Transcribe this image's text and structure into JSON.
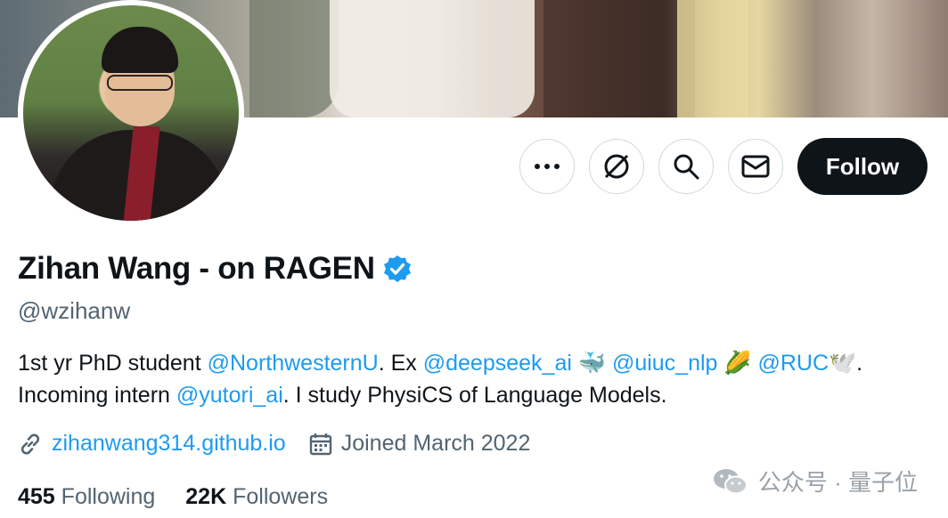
{
  "profile": {
    "display_name": "Zihan Wang - on RAGEN",
    "handle": "@wzihanw",
    "bio": {
      "line1": [
        {
          "text": "1st yr PhD student ",
          "type": "text"
        },
        {
          "text": "@NorthwesternU",
          "type": "mention"
        },
        {
          "text": ". Ex ",
          "type": "text"
        },
        {
          "text": "@deepseek_ai",
          "type": "mention"
        },
        {
          "text": " 🐳 ",
          "type": "text"
        },
        {
          "text": "@uiuc_nlp",
          "type": "mention"
        },
        {
          "text": " 🌽 ",
          "type": "text"
        },
        {
          "text": "@RUC",
          "type": "mention"
        },
        {
          "text": "🕊️.",
          "type": "text"
        }
      ],
      "line2": [
        {
          "text": "Incoming intern ",
          "type": "text"
        },
        {
          "text": "@yutori_ai",
          "type": "mention"
        },
        {
          "text": ". I study PhysiCS of Language Models.",
          "type": "text"
        }
      ]
    },
    "website": "zihanwang314.github.io",
    "joined": "Joined March 2022",
    "following_count": "455",
    "following_label": "Following",
    "followers_count": "22K",
    "followers_label": "Followers"
  },
  "actions": {
    "more_icon": "more-icon",
    "grok_icon": "grok-icon",
    "search_icon": "search-icon",
    "message_icon": "mail-icon",
    "follow_label": "Follow"
  },
  "watermark": {
    "text": "公众号 · 量子位",
    "icon": "wechat-icon"
  },
  "colors": {
    "accent": "#1d9bf0",
    "text": "#0f1419",
    "secondary": "#536471",
    "verified": "#1d9bf0"
  }
}
